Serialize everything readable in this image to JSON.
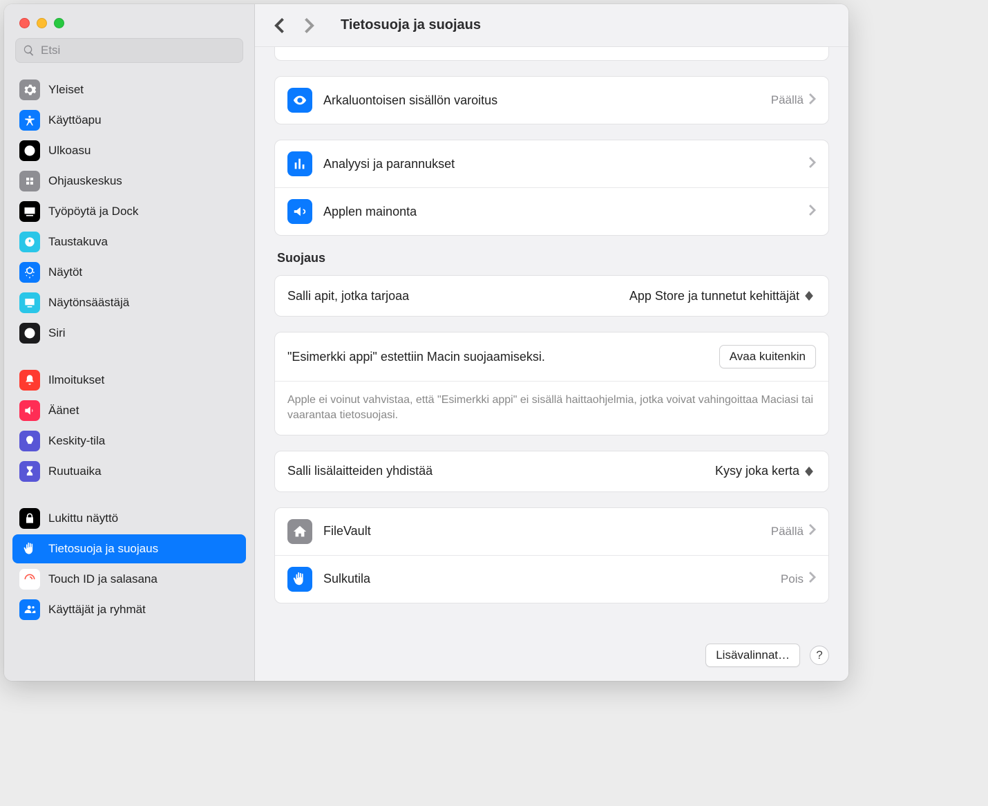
{
  "search": {
    "placeholder": "Etsi"
  },
  "header": {
    "title": "Tietosuoja ja suojaus"
  },
  "sidebar": {
    "items": [
      {
        "label": "Yleiset",
        "bg": "#8e8e93",
        "icon": "gear"
      },
      {
        "label": "Käyttöapu",
        "bg": "#0a7aff",
        "icon": "accessibility"
      },
      {
        "label": "Ulkoasu",
        "bg": "#000000",
        "icon": "appearance"
      },
      {
        "label": "Ohjauskeskus",
        "bg": "#8e8e93",
        "icon": "control"
      },
      {
        "label": "Työpöytä ja Dock",
        "bg": "#000000",
        "icon": "dock"
      },
      {
        "label": "Taustakuva",
        "bg": "#2ac6e8",
        "icon": "wallpaper"
      },
      {
        "label": "Näytöt",
        "bg": "#0a7aff",
        "icon": "displays"
      },
      {
        "label": "Näytönsäästäjä",
        "bg": "#2ac6e8",
        "icon": "screensaver"
      },
      {
        "label": "Siri",
        "bg": "#1b1b1d",
        "icon": "siri"
      }
    ],
    "items2": [
      {
        "label": "Ilmoitukset",
        "bg": "#ff3b30",
        "icon": "bell"
      },
      {
        "label": "Äänet",
        "bg": "#ff2d55",
        "icon": "sound"
      },
      {
        "label": "Keskity-tila",
        "bg": "#5856d6",
        "icon": "focus"
      },
      {
        "label": "Ruutuaika",
        "bg": "#5856d6",
        "icon": "hourglass"
      }
    ],
    "items3": [
      {
        "label": "Lukittu näyttö",
        "bg": "#000000",
        "icon": "lock"
      },
      {
        "label": "Tietosuoja ja suojaus",
        "bg": "#0a7aff",
        "icon": "hand",
        "selected": true
      },
      {
        "label": "Touch ID ja salasana",
        "bg": "#ffffff",
        "icon": "touchid"
      },
      {
        "label": "Käyttäjät ja ryhmät",
        "bg": "#0a7aff",
        "icon": "users"
      }
    ]
  },
  "rows": {
    "sensitive": {
      "label": "Arkaluontoisen sisällön varoitus",
      "value": "Päällä"
    },
    "analytics": {
      "label": "Analyysi ja parannukset"
    },
    "ads": {
      "label": "Applen mainonta"
    }
  },
  "security": {
    "header": "Suojaus",
    "allow_apps_label": "Salli apit, jotka tarjoaa",
    "allow_apps_value": "App Store ja tunnetut kehittäjät",
    "blocked_msg": "\"Esimerkki appi\" estettiin Macin suojaamiseksi.",
    "open_anyway": "Avaa kuitenkin",
    "blocked_sub": "Apple ei voinut vahvistaa, että \"Esimerkki appi\" ei sisällä haittaohjelmia, jotka voivat vahingoittaa Maciasi tai vaarantaa tietosuojasi.",
    "accessories_label": "Salli lisälaitteiden yhdistää",
    "accessories_value": "Kysy joka kerta",
    "filevault_label": "FileVault",
    "filevault_value": "Päällä",
    "lockdown_label": "Sulkutila",
    "lockdown_value": "Pois"
  },
  "footer": {
    "advanced": "Lisävalinnat…",
    "help": "?"
  }
}
